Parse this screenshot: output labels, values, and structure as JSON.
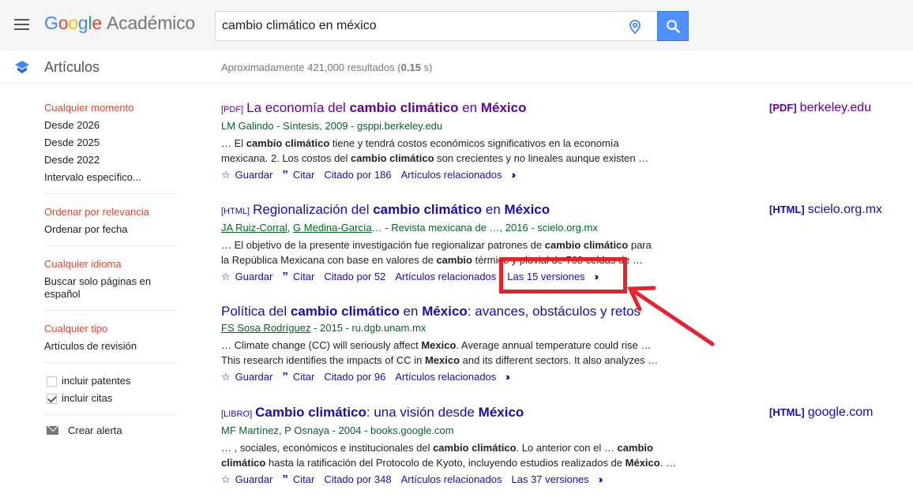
{
  "header": {
    "logo_google": [
      "G",
      "o",
      "o",
      "g",
      "l",
      "e"
    ],
    "logo_sub": "Académico",
    "search_value": "cambio climático en méxico"
  },
  "subheader": {
    "section": "Artículos",
    "results_prefix": "Aproximadamente 421,000 resultados (",
    "results_time": "0.15",
    "results_suffix": " s)"
  },
  "sidebar": {
    "time": [
      "Cualquier momento",
      "Desde 2026",
      "Desde 2025",
      "Desde 2022",
      "Intervalo específico..."
    ],
    "sort": [
      "Ordenar por relevancia",
      "Ordenar por fecha"
    ],
    "lang": [
      "Cualquier idioma",
      "Buscar solo páginas en español"
    ],
    "type": [
      "Cualquier tipo",
      "Artículos de revisión"
    ],
    "checks": [
      {
        "label": "incluir patentes",
        "checked": false
      },
      {
        "label": "incluir citas",
        "checked": true
      }
    ],
    "alert": "Crear alerta"
  },
  "results": [
    {
      "tag": "[PDF]",
      "title_parts": [
        [
          "La economía del ",
          false
        ],
        [
          "cambio climático",
          true
        ],
        [
          " en ",
          false
        ],
        [
          "México",
          true
        ]
      ],
      "meta": "LM Galindo - Síntesis, 2009 - gsppi.berkeley.edu",
      "snippet1": [
        [
          "… El ",
          false
        ],
        [
          "cambio climático",
          true
        ],
        [
          " tiene y tendrá costos económicos significativos en la economía",
          false
        ]
      ],
      "snippet2": [
        [
          "mexicana. 2. Los costos del ",
          false
        ],
        [
          "cambio climático",
          true
        ],
        [
          " son crecientes y no lineales aunque existen …",
          false
        ]
      ],
      "links": [
        "Guardar",
        "Citar",
        "Citado por 186",
        "Artículos relacionados"
      ],
      "side_tag": "[PDF]",
      "side_domain": "berkeley.edu"
    },
    {
      "tag": "[HTML]",
      "title_parts": [
        [
          "Regionalización del ",
          false
        ],
        [
          "cambio climático",
          true
        ],
        [
          " en ",
          false
        ],
        [
          "México",
          true
        ]
      ],
      "meta_authors": [
        "JA Ruiz-Corral",
        "G Medina-García"
      ],
      "meta_rest": "… - Revista mexicana de …, 2016 - scielo.org.mx",
      "snippet1": [
        [
          "… El objetivo de la presente investigación fue regionalizar patrones de ",
          false
        ],
        [
          "cambio climático",
          true
        ],
        [
          " para",
          false
        ]
      ],
      "snippet2": [
        [
          "la República Mexicana con base en valores de ",
          false
        ],
        [
          "cambio",
          true
        ],
        [
          " térmico y pluvial de 708 celdas de …",
          false
        ]
      ],
      "links": [
        "Guardar",
        "Citar",
        "Citado por 52",
        "Artículos relacionados",
        "Las 15 versiones"
      ],
      "side_tag": "[HTML]",
      "side_domain": "scielo.org.mx"
    },
    {
      "title_parts": [
        [
          "Política del ",
          false
        ],
        [
          "cambio climático",
          true
        ],
        [
          " en ",
          false
        ],
        [
          "México",
          true
        ],
        [
          ": avances, obstáculos y retos",
          false
        ]
      ],
      "meta_authors": [
        "FS Sosa Rodríguez"
      ],
      "meta_rest": " - 2015 - ru.dgb.unam.mx",
      "snippet1": [
        [
          "… Climate change (CC) will seriously affect ",
          false
        ],
        [
          "Mexico",
          true
        ],
        [
          ". Average annual temperature could rise …",
          false
        ]
      ],
      "snippet2": [
        [
          "This research identifies the impacts of CC in ",
          false
        ],
        [
          "Mexico",
          true
        ],
        [
          " and its different sectors. It also analyzes …",
          false
        ]
      ],
      "links": [
        "Guardar",
        "Citar",
        "Citado por 96",
        "Artículos relacionados"
      ]
    },
    {
      "tag": "[LIBRO]",
      "title_parts": [
        [
          "Cambio climático",
          true
        ],
        [
          ": una visión desde ",
          false
        ],
        [
          "México",
          true
        ]
      ],
      "meta": "MF Martínez, P Osnaya - 2004 - books.google.com",
      "snippet1": [
        [
          "… , sociales, económicos e institucionales del ",
          false
        ],
        [
          "cambio climático",
          true
        ],
        [
          ". Lo anterior con el … ",
          false
        ],
        [
          "cambio",
          true
        ]
      ],
      "snippet2": [
        [
          "climático",
          true
        ],
        [
          " hasta la ratificación del Protocolo de Kyoto, incluyendo estudios realizados de ",
          false
        ],
        [
          "México",
          true
        ],
        [
          ". …",
          false
        ]
      ],
      "links": [
        "Guardar",
        "Citar",
        "Citado por 348",
        "Artículos relacionados",
        "Las 37 versiones"
      ],
      "side_tag": "[HTML]",
      "side_domain": "google.com"
    }
  ],
  "colors": {
    "annotation": "#e5222e",
    "link": "#1a0dab",
    "visited": "#660099",
    "green": "#006621"
  }
}
